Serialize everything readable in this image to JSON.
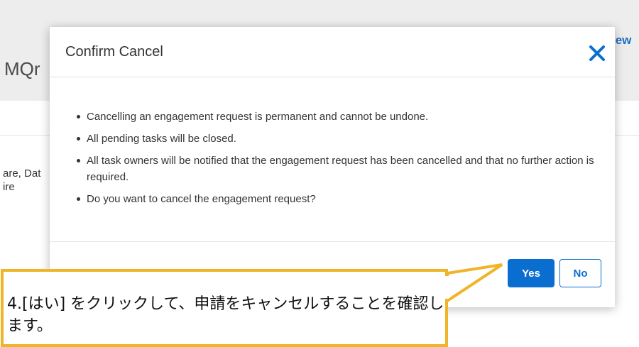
{
  "background": {
    "title_fragment": "MQr",
    "link_fragment": "iew",
    "side_text": "are, Dat\nire"
  },
  "dialog": {
    "title": "Confirm Cancel",
    "close_icon": "close-icon",
    "bullets": [
      "Cancelling an engagement request is permanent and cannot be undone.",
      "All pending tasks will be closed.",
      "All task owners will be notified that the engagement request has been cancelled and that no further action is required.",
      "Do you want to cancel the engagement request?"
    ],
    "yes_label": "Yes",
    "no_label": "No"
  },
  "callout": {
    "text": "4.[はい] をクリックして、申請をキャンセルすることを確認します。"
  },
  "colors": {
    "accent": "#0a6ed1",
    "callout_border": "#f0b429",
    "header_bg": "#ededed"
  }
}
